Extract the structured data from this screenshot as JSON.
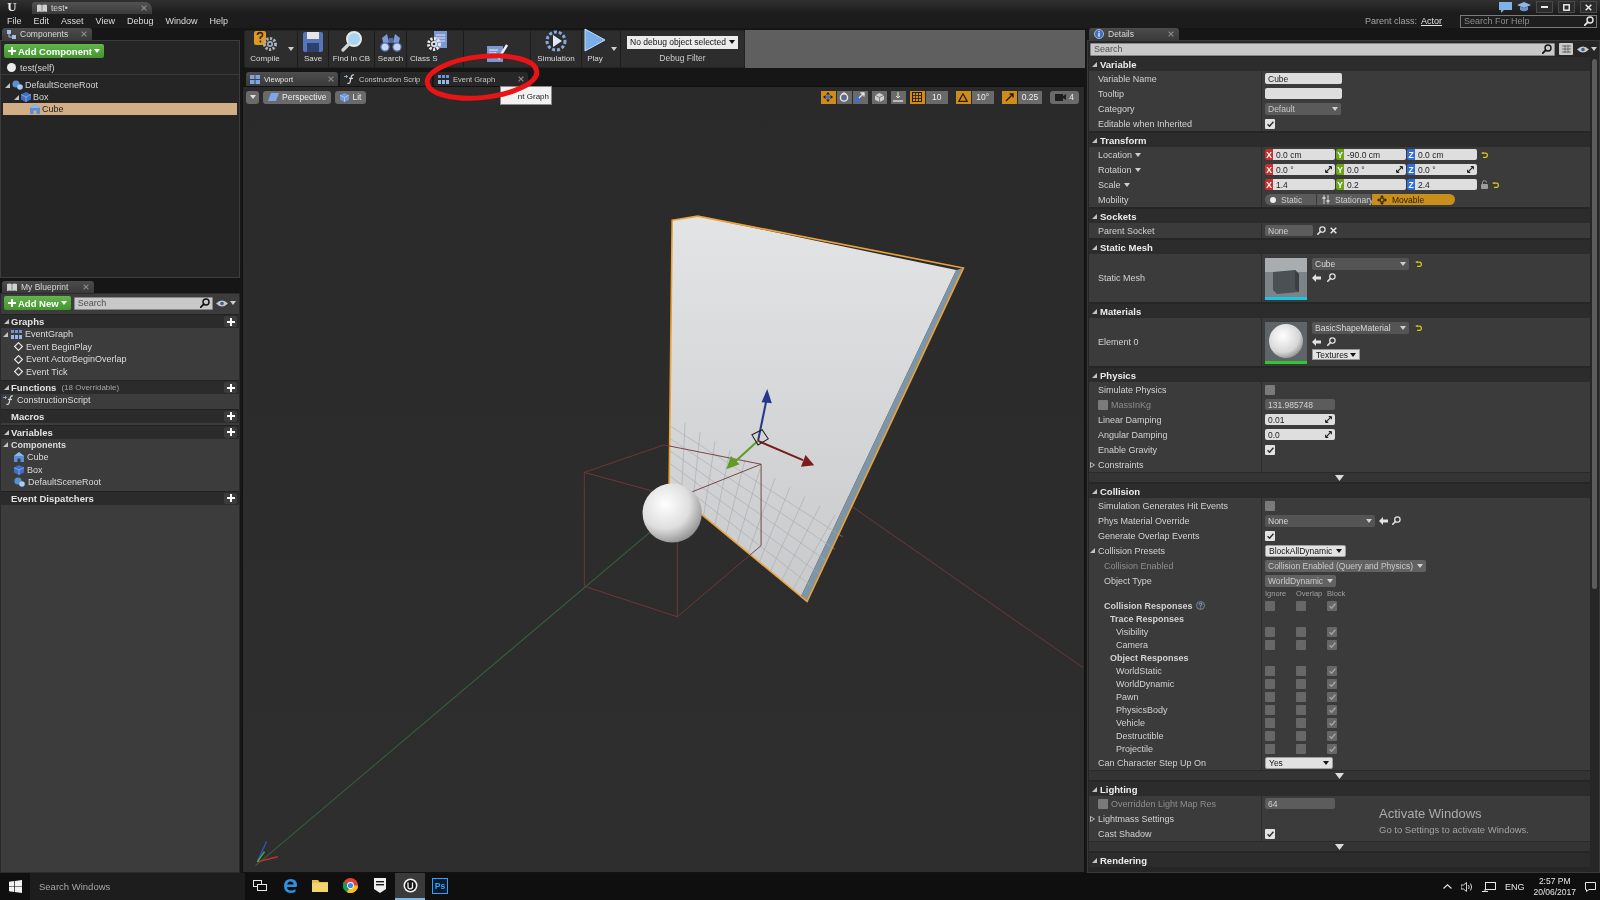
{
  "title_bar": {
    "logo": "U",
    "tab": "test•"
  },
  "menu_bar": {
    "items": [
      "File",
      "Edit",
      "Asset",
      "View",
      "Debug",
      "Window",
      "Help"
    ],
    "parent_class_label": "Parent class:",
    "parent_class": "Actor",
    "help_search": {
      "placeholder": "Search For Help"
    }
  },
  "components_panel": {
    "tab": "Components",
    "add_button": "Add Component",
    "self_item": "test(self)",
    "tree": [
      {
        "label": "DefaultSceneRoot",
        "kind": "scene",
        "expanded": true,
        "selected": false,
        "children": [
          {
            "label": "Box",
            "kind": "box",
            "expanded": true,
            "selected": false,
            "children": [
              {
                "label": "Cube",
                "kind": "mesh",
                "selected": true
              }
            ]
          }
        ]
      }
    ]
  },
  "my_blueprint": {
    "tab": "My Blueprint",
    "add_button": "Add New",
    "search": {
      "placeholder": "Search"
    },
    "categories": [
      {
        "title": "Graphs",
        "expanded": true,
        "add": true,
        "items": [
          {
            "label": "EventGraph",
            "kind": "graph",
            "expanded": true,
            "children": [
              {
                "label": "Event BeginPlay",
                "kind": "event"
              },
              {
                "label": "Event ActorBeginOverlap",
                "kind": "event"
              },
              {
                "label": "Event Tick",
                "kind": "event"
              }
            ]
          }
        ]
      },
      {
        "title": "Functions",
        "note": "(18 Overridable)",
        "expanded": true,
        "add": true,
        "items": [
          {
            "label": "ConstructionScript",
            "kind": "function"
          }
        ]
      },
      {
        "title": "Macros",
        "add": true
      },
      {
        "title": "Variables",
        "expanded": true,
        "add": true,
        "items": [
          {
            "label": "Components",
            "kind": "category",
            "expanded": true,
            "children": [
              {
                "label": "Cube",
                "kind": "mesh"
              },
              {
                "label": "Box",
                "kind": "box"
              },
              {
                "label": "DefaultSceneRoot",
                "kind": "scene"
              }
            ]
          }
        ]
      },
      {
        "title": "Event Dispatchers",
        "add": true
      }
    ]
  },
  "toolbar": {
    "buttons": [
      {
        "kind": "compile",
        "label": "Compile",
        "dropdown": true
      },
      {
        "kind": "save",
        "label": "Save"
      },
      {
        "kind": "find",
        "label": "Find in CB"
      },
      {
        "kind": "search",
        "label": "Search"
      },
      {
        "kind": "class-settings",
        "label": "Class S"
      },
      {
        "kind": "class-defaults"
      },
      {
        "kind": "simulation",
        "label": "Simulation"
      },
      {
        "kind": "play",
        "label": "Play",
        "dropdown": true
      }
    ],
    "debug_filter": {
      "value": "No debug object selected",
      "label": "Debug Filter"
    }
  },
  "editor_tabs": [
    {
      "label": "Viewport",
      "kind": "viewport",
      "selected": true,
      "close_button": true
    },
    {
      "label": "Construction Scrip",
      "kind": "function",
      "selected": false
    },
    {
      "label": "Event Graph",
      "kind": "graph",
      "selected": false,
      "close_button": true
    }
  ],
  "tooltip": "nt Graph",
  "annotation": {
    "kind": "ellipse"
  },
  "viewport": {
    "view_buttons": [
      {
        "kind": "perspective",
        "label": "Perspective"
      },
      {
        "kind": "lit",
        "label": "Lit"
      }
    ],
    "transform_modes": [
      {
        "kind": "translate",
        "selected": true
      },
      {
        "kind": "rotate",
        "selected": false
      },
      {
        "kind": "scale",
        "selected": false
      }
    ],
    "snaps": [
      {
        "kind": "grid",
        "on": true,
        "value": "10"
      },
      {
        "kind": "rotation",
        "on": true,
        "value": "10°"
      },
      {
        "kind": "scale",
        "on": true,
        "value": "0.25"
      }
    ],
    "camera_speed": "4"
  },
  "details": {
    "tab": "Details",
    "search": {
      "placeholder": "Search"
    },
    "sections": [
      {
        "title": "Variable",
        "expanded": true,
        "rows": [
          {
            "kind": "text",
            "label": "Variable Name",
            "value": "Cube"
          },
          {
            "kind": "text",
            "label": "Tooltip"
          },
          {
            "kind": "combo",
            "label": "Category",
            "value": "Default"
          },
          {
            "kind": "checkbox",
            "label": "Editable when Inherited",
            "checked": true,
            "disabled": false
          }
        ]
      },
      {
        "title": "Transform",
        "expanded": true,
        "rows": [
          {
            "kind": "vector",
            "label": "Location",
            "menu": true,
            "reset": true,
            "fields": [
              {
                "axis": "X",
                "color": "#c8302b",
                "value": "0.0 cm"
              },
              {
                "axis": "Y",
                "color": "#6aa51c",
                "value": "-90.0 cm"
              },
              {
                "axis": "Z",
                "color": "#2e6fd8",
                "value": "0.0 cm"
              }
            ]
          },
          {
            "kind": "vector",
            "label": "Rotation",
            "menu": true,
            "spin": true,
            "fields": [
              {
                "axis": "X",
                "color": "#c8302b",
                "value": "0.0 °"
              },
              {
                "axis": "Y",
                "color": "#6aa51c",
                "value": "0.0 °"
              },
              {
                "axis": "Z",
                "color": "#2e6fd8",
                "value": "0.0 °"
              }
            ]
          },
          {
            "kind": "vector",
            "label": "Scale",
            "menu": true,
            "lock": true,
            "reset": true,
            "fields": [
              {
                "axis": "X",
                "color": "#c8302b",
                "value": "1.4"
              },
              {
                "axis": "Y",
                "color": "#6aa51c",
                "value": "0.2"
              },
              {
                "axis": "Z",
                "color": "#2e6fd8",
                "value": "2.4"
              }
            ]
          },
          {
            "kind": "mobility",
            "label": "Mobility",
            "options": [
              {
                "label": "Static",
                "kind": "static",
                "selected": false
              },
              {
                "label": "Stationary",
                "kind": "stationary",
                "selected": false
              },
              {
                "label": "Movable",
                "kind": "movable",
                "selected": true
              }
            ]
          }
        ]
      },
      {
        "title": "Sockets",
        "expanded": true,
        "rows": [
          {
            "kind": "socket",
            "label": "Parent Socket",
            "value": "None"
          }
        ]
      },
      {
        "title": "Static Mesh",
        "expanded": true,
        "rows": [
          {
            "kind": "mesh-asset",
            "label": "Static Mesh",
            "value": "Cube",
            "reset": true
          }
        ]
      },
      {
        "title": "Materials",
        "expanded": true,
        "rows": [
          {
            "kind": "material-asset",
            "label": "Element 0",
            "value": "BasicShapeMaterial",
            "reset": true,
            "button": "Textures"
          }
        ]
      },
      {
        "title": "Physics",
        "expanded": true,
        "advanced": true,
        "rows": [
          {
            "kind": "checkbox",
            "label": "Simulate Physics",
            "checked": false,
            "disabled": false
          },
          {
            "kind": "override",
            "label": "MassInKg",
            "checked": false,
            "value": "131.985748"
          },
          {
            "kind": "number",
            "label": "Linear Damping",
            "value": "0.01",
            "spin": true
          },
          {
            "kind": "number",
            "label": "Angular Damping",
            "value": "0.0",
            "spin": true
          },
          {
            "kind": "checkbox",
            "label": "Enable Gravity",
            "checked": true,
            "disabled": false
          },
          {
            "kind": "group",
            "label": "Constraints",
            "expanded": false
          }
        ]
      },
      {
        "title": "Collision",
        "expanded": true,
        "advanced": true,
        "rows": [
          {
            "kind": "checkbox",
            "label": "Simulation Generates Hit Events",
            "checked": false,
            "disabled": false
          },
          {
            "kind": "picker",
            "label": "Phys Material Override",
            "value": "None"
          },
          {
            "kind": "checkbox",
            "label": "Generate Overlap Events",
            "checked": true,
            "disabled": false
          },
          {
            "kind": "dropdown",
            "label": "Collision Presets",
            "value": "BlockAllDynamic",
            "disabled": false,
            "expanded": true,
            "children": [
              {
                "kind": "dropdown",
                "label": "Collision Enabled",
                "value": "Collision Enabled (Query and Physics)",
                "disabled": true,
                "label_muted": true
              },
              {
                "kind": "dropdown",
                "label": "Object Type",
                "value": "WorldDynamic",
                "disabled": true
              },
              {
                "kind": "columns",
                "labels": [
                  "Ignore",
                  "Overlap",
                  "Block"
                ]
              },
              {
                "kind": "responses",
                "label": "Collision Responses",
                "bold": true,
                "help": true,
                "disabled": true,
                "checks": [
                  false,
                  false,
                  true
                ],
                "children": [
                  {
                    "kind": "heading",
                    "label": "Trace Responses",
                    "children": [
                      {
                        "kind": "responses",
                        "label": "Visibility",
                        "disabled": true,
                        "checks": [
                          false,
                          false,
                          true
                        ]
                      },
                      {
                        "kind": "responses",
                        "label": "Camera",
                        "disabled": true,
                        "checks": [
                          false,
                          false,
                          true
                        ]
                      }
                    ]
                  },
                  {
                    "kind": "heading",
                    "label": "Object Responses",
                    "children": [
                      {
                        "kind": "responses",
                        "label": "WorldStatic",
                        "disabled": true,
                        "checks": [
                          false,
                          false,
                          true
                        ]
                      },
                      {
                        "kind": "responses",
                        "label": "WorldDynamic",
                        "disabled": true,
                        "checks": [
                          false,
                          false,
                          true
                        ]
                      },
                      {
                        "kind": "responses",
                        "label": "Pawn",
                        "disabled": true,
                        "checks": [
                          false,
                          false,
                          true
                        ]
                      },
                      {
                        "kind": "responses",
                        "label": "PhysicsBody",
                        "disabled": true,
                        "checks": [
                          false,
                          false,
                          true
                        ]
                      },
                      {
                        "kind": "responses",
                        "label": "Vehicle",
                        "disabled": true,
                        "checks": [
                          false,
                          false,
                          true
                        ]
                      },
                      {
                        "kind": "responses",
                        "label": "Destructible",
                        "disabled": true,
                        "checks": [
                          false,
                          false,
                          true
                        ]
                      },
                      {
                        "kind": "responses",
                        "label": "Projectile",
                        "disabled": true,
                        "checks": [
                          false,
                          false,
                          true
                        ]
                      }
                    ]
                  }
                ]
              }
            ]
          },
          {
            "kind": "dropdown",
            "label": "Can Character Step Up On",
            "value": "Yes",
            "disabled": false
          }
        ]
      },
      {
        "title": "Lighting",
        "expanded": true,
        "advanced": true,
        "rows": [
          {
            "kind": "override",
            "label": "Overridden Light Map Res",
            "checked": false,
            "value": "64"
          },
          {
            "kind": "group",
            "label": "Lightmass Settings",
            "expanded": false
          },
          {
            "kind": "checkbox",
            "label": "Cast Shadow",
            "checked": true,
            "disabled": false
          }
        ]
      },
      {
        "title": "Rendering",
        "expanded": true
      }
    ]
  },
  "taskbar": {
    "search": {
      "placeholder": "Search Windows"
    },
    "apps": [
      {
        "kind": "task-view",
        "active": false
      },
      {
        "kind": "edge",
        "active": false
      },
      {
        "kind": "explorer",
        "active": false
      },
      {
        "kind": "chrome",
        "active": false
      },
      {
        "kind": "epic",
        "active": false
      },
      {
        "kind": "unreal",
        "active": true
      },
      {
        "kind": "photoshop",
        "label": "Ps",
        "active": false
      }
    ],
    "language": "ENG",
    "time": "2:57 PM",
    "date": "20/06/2017"
  },
  "activation_notice": {
    "title": "Activate Windows",
    "subtitle": "Go to Settings to activate Windows."
  }
}
